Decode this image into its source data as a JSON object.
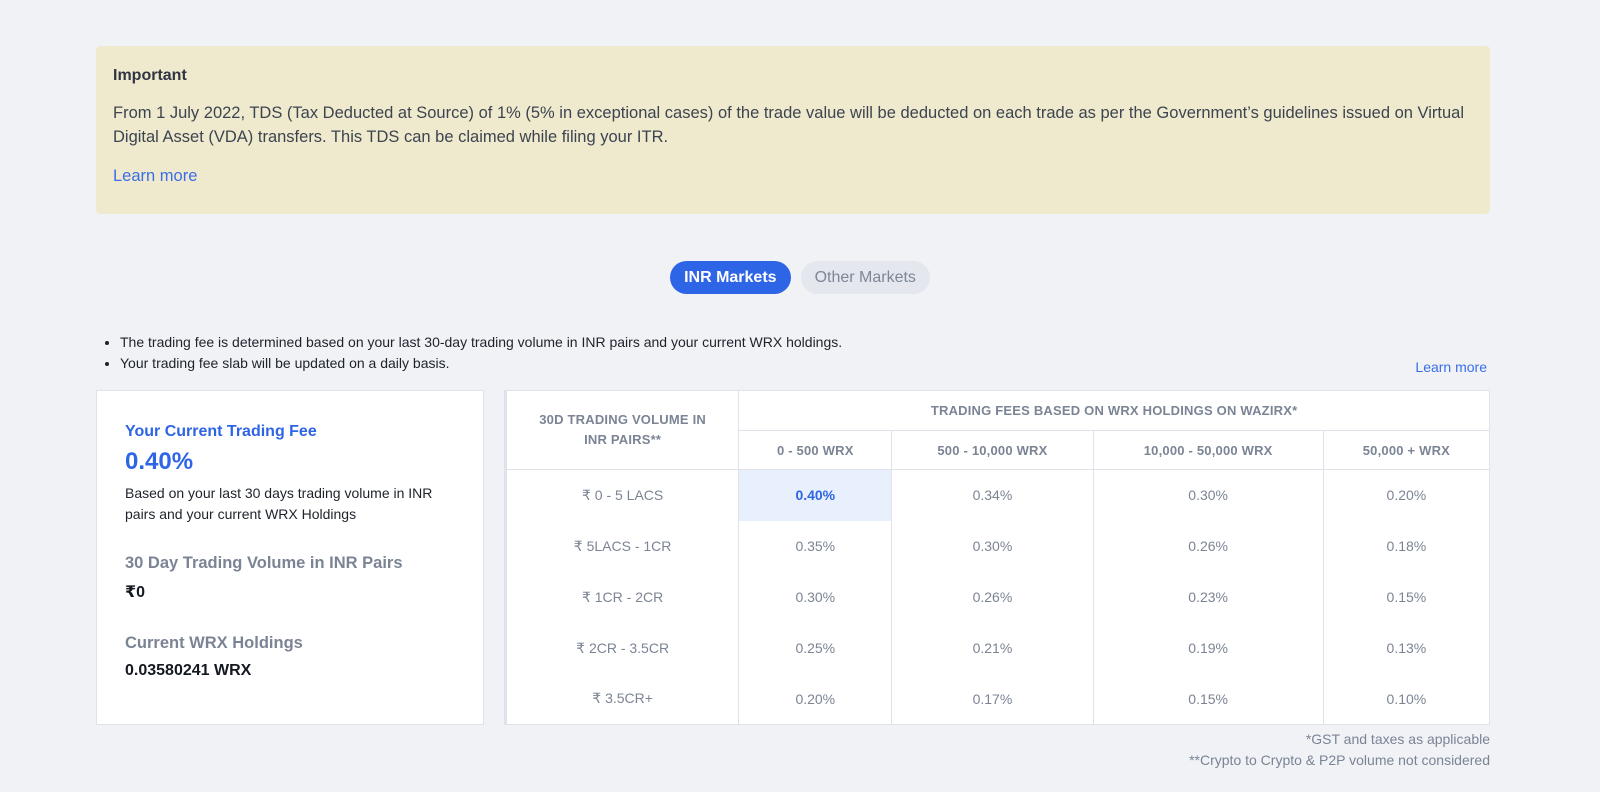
{
  "notice": {
    "title": "Important",
    "text": "From 1 July 2022, TDS (Tax Deducted at Source) of 1% (5% in exceptional cases) of the trade value will be deducted on each trade as per the Government’s guidelines issued on Virtual Digital Asset (VDA) transfers. This TDS can be claimed while filing your ITR.",
    "link": "Learn more"
  },
  "tabs": [
    {
      "label": "INR Markets",
      "active": true
    },
    {
      "label": "Other Markets",
      "active": false
    }
  ],
  "info": {
    "bullets": [
      "The trading fee is determined based on your last 30-day trading volume in INR pairs and your current WRX holdings.",
      "Your trading fee slab will be updated on a daily basis."
    ],
    "learn_more": "Learn more"
  },
  "fee_card": {
    "current_label": "Your Current Trading Fee",
    "current_value": "0.40%",
    "description": "Based on your last 30 days trading volume in INR pairs and your current WRX Holdings",
    "volume_label": "30 Day Trading Volume in INR Pairs",
    "volume_value": "₹0",
    "holdings_label": "Current WRX Holdings",
    "holdings_value": "0.03580241 WRX"
  },
  "fee_table": {
    "volume_header": "30D TRADING VOLUME IN INR PAIRS**",
    "group_header": "TRADING FEES BASED ON WRX HOLDINGS ON WAZIRX*",
    "columns": [
      "0 - 500 WRX",
      "500 - 10,000 WRX",
      "10,000 - 50,000 WRX",
      "50,000 + WRX"
    ],
    "rows": [
      {
        "volume": "₹ 0 - 5 LACS",
        "fees": [
          "0.40%",
          "0.34%",
          "0.30%",
          "0.20%"
        ]
      },
      {
        "volume": "₹ 5LACS - 1CR",
        "fees": [
          "0.35%",
          "0.30%",
          "0.26%",
          "0.18%"
        ]
      },
      {
        "volume": "₹ 1CR - 2CR",
        "fees": [
          "0.30%",
          "0.26%",
          "0.23%",
          "0.15%"
        ]
      },
      {
        "volume": "₹ 2CR - 3.5CR",
        "fees": [
          "0.25%",
          "0.21%",
          "0.19%",
          "0.13%"
        ]
      },
      {
        "volume": "₹ 3.5CR+",
        "fees": [
          "0.20%",
          "0.17%",
          "0.15%",
          "0.10%"
        ]
      }
    ],
    "current_cell": {
      "row": 0,
      "col": 0
    }
  },
  "footnotes": [
    "*GST and taxes as applicable",
    "**Crypto to Crypto & P2P volume not considered"
  ],
  "colors": {
    "accent": "#2e64e6",
    "notice_bg": "#efeacd",
    "page_bg": "#f0f2f6"
  }
}
